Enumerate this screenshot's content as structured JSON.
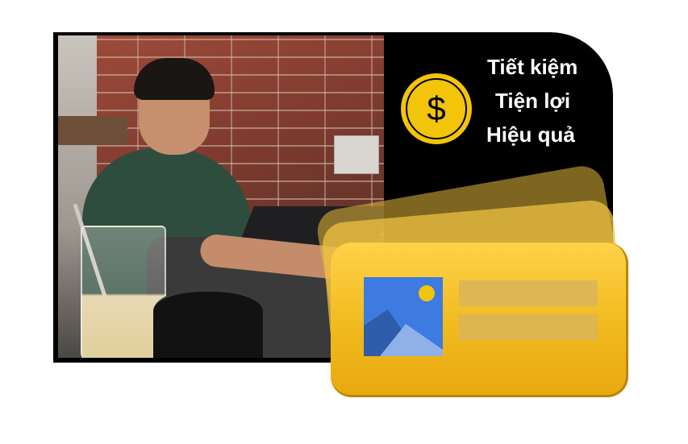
{
  "features": [
    "Tiết kiệm",
    "Tiện lợi",
    "Hiệu quả"
  ],
  "coin": {
    "symbol": "$",
    "icon": "dollar-coin-icon",
    "color": "#f2c40a"
  },
  "card": {
    "icon": "image-placeholder-icon",
    "color": "#f1ba1e",
    "accent": "#3d7be0"
  },
  "colors": {
    "panel": "#000000",
    "text": "#ffffff"
  }
}
